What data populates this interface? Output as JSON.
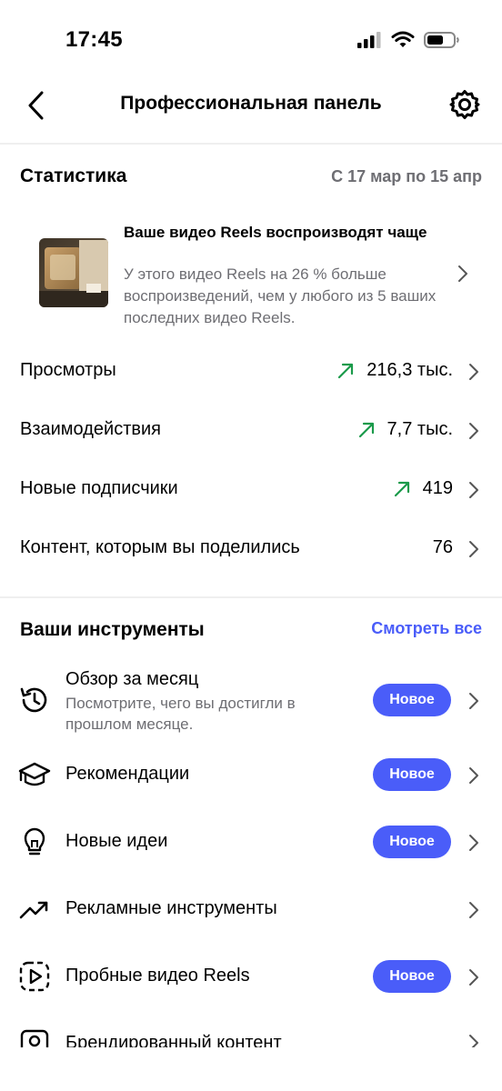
{
  "status_bar": {
    "time": "17:45"
  },
  "header": {
    "title": "Профессиональная панель"
  },
  "stats": {
    "title": "Статистика",
    "date_range": "С 17 мар по 15 апр",
    "reel_card": {
      "title": "Ваше видео Reels воспроизводят чаще",
      "description": "У этого видео Reels на 26 % больше воспроизведений, чем у любого из 5 ваших последних видео Reels."
    },
    "rows": [
      {
        "label": "Просмотры",
        "value": "216,3 тыс.",
        "trend": "up"
      },
      {
        "label": "Взаимодействия",
        "value": "7,7 тыс.",
        "trend": "up"
      },
      {
        "label": "Новые подписчики",
        "value": "419",
        "trend": "up"
      },
      {
        "label": "Контент, которым вы поделились",
        "value": "76",
        "trend": "none"
      }
    ]
  },
  "tools": {
    "title": "Ваши инструменты",
    "see_all": "Смотреть все",
    "items": [
      {
        "label": "Обзор за месяц",
        "subtitle": "Посмотрите, чего вы достигли в прошлом месяце.",
        "badge": "Новое",
        "icon": "history-icon"
      },
      {
        "label": "Рекомендации",
        "badge": "Новое",
        "icon": "graduation-cap-icon"
      },
      {
        "label": "Новые идеи",
        "badge": "Новое",
        "icon": "lightbulb-icon"
      },
      {
        "label": "Рекламные инструменты",
        "icon": "trending-up-icon"
      },
      {
        "label": "Пробные видео Reels",
        "badge": "Новое",
        "icon": "reels-trial-icon"
      },
      {
        "label": "Брендированный контент",
        "icon": "branded-content-icon"
      }
    ]
  },
  "colors": {
    "accent": "#4a5df9",
    "trend_up": "#1a9a4a",
    "secondary_text": "#6e6e73"
  }
}
